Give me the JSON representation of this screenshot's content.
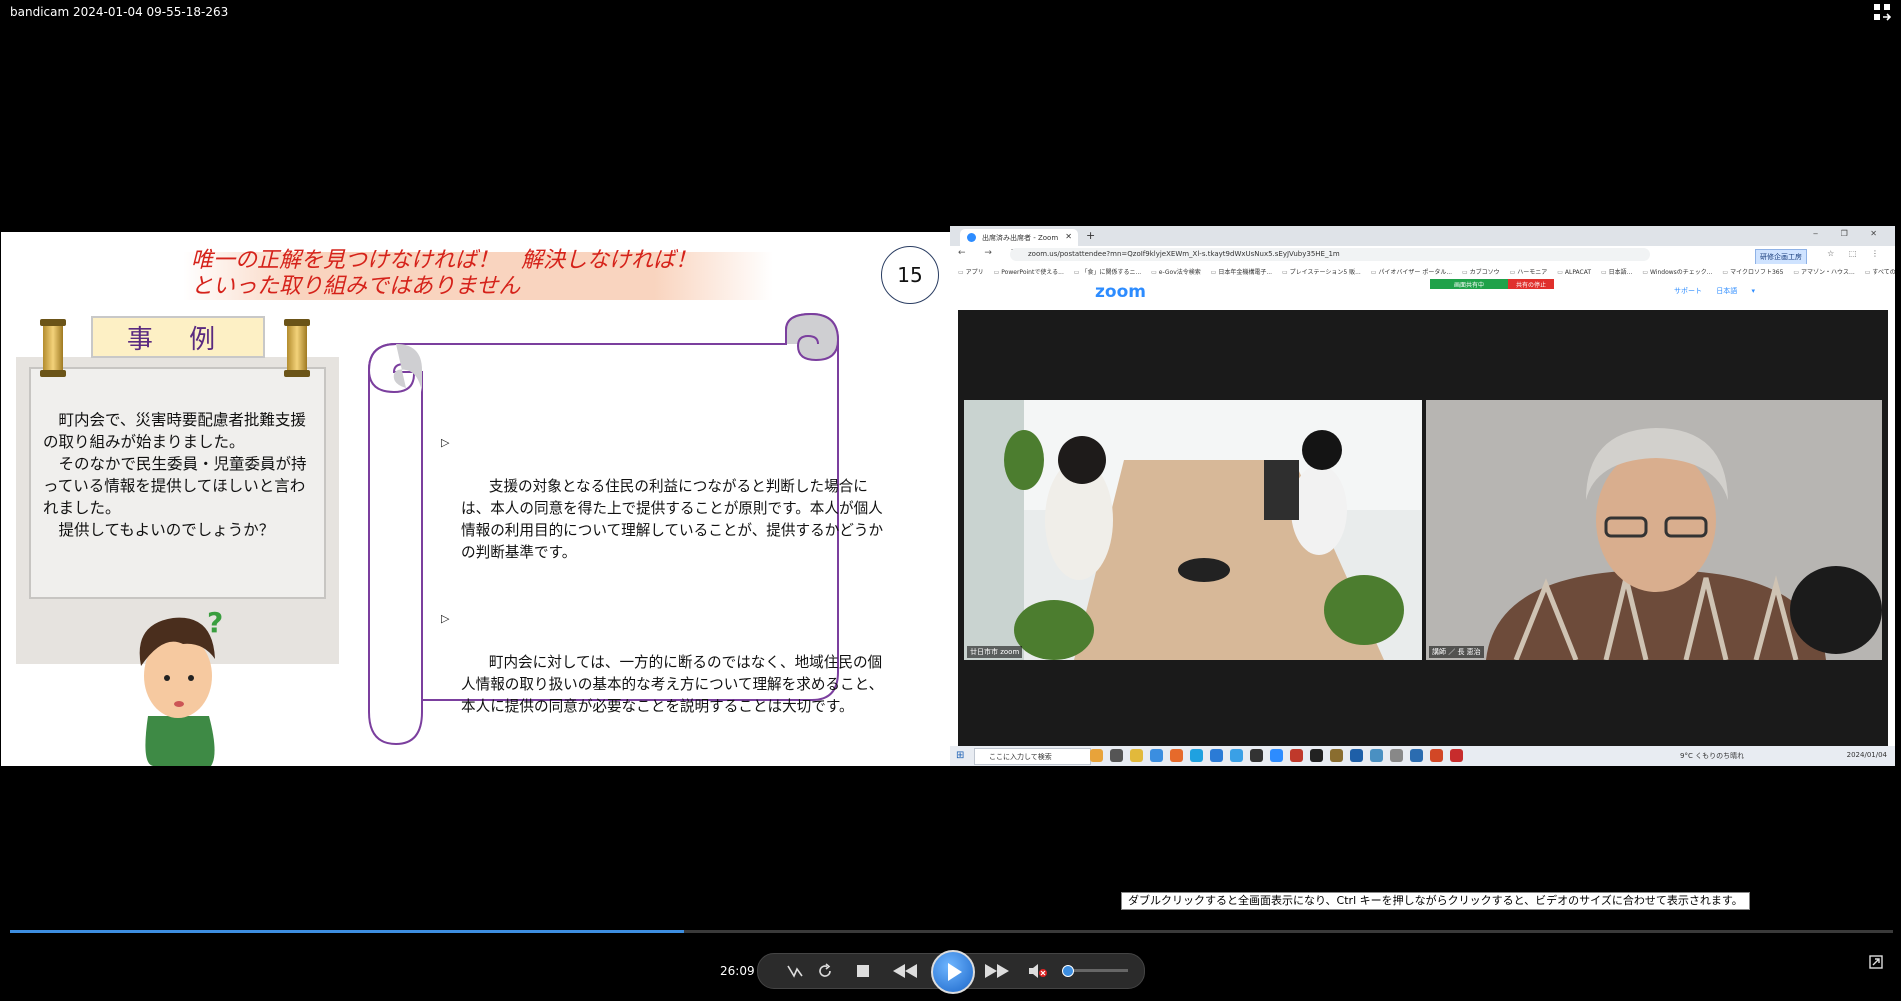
{
  "window": {
    "title": "bandicam 2024-01-04 09-55-18-263"
  },
  "slide": {
    "title_lines": [
      "唯一の正解を見つけなければ！　解決しなければ！",
      "といった取り組みではありません"
    ],
    "page_number": "15",
    "case_label": "事 例",
    "case_text": "　町内会で、災害時要配慮者批難支援の取り組みが始まりました。\n　そのなかで民生委員・児童委員が持っている情報を提供してほしいと言われました。\n　提供してもよいのでしょうか？",
    "bullets": [
      "支援の対象となる住民の利益につながると判断した場合には、本人の同意を得た上で提供することが原則です。本人が個人情報の利用目的について理解していることが、提供するかどうかの判断基準です。",
      "町内会に対しては、一方的に断るのではなく、地域住民の個人情報の取り扱いの基本的な考え方について理解を求めること、本人に提供の同意が必要なことを説明することは大切です。"
    ],
    "bullet_marker": "▷"
  },
  "browser": {
    "tab_title": "出席済み出席者 - Zoom",
    "url": "zoom.us/postattendee?mn=QzoIf9klyjeXEWm_Xl-s.tkayt9dWxUsNux5.sEyJVuby35HE_1m",
    "bookmarks": [
      "アプリ",
      "PowerPointで使える...",
      "「食」に関係するニ...",
      "e-Gov法令検索",
      "日本年金機構電子...",
      "プレイステーション5 販...",
      "パイオバイザー ポータル...",
      "カブコソウ",
      "ハーモニア",
      "ALPACAT",
      "日本語...",
      "Windowsのチェック...",
      "マイクロソフト365",
      "アマゾン・ハウス..."
    ],
    "bookmarks_more": "すべてのブックマーク",
    "share_status": "画面共有中",
    "share_stop": "共有の停止",
    "share_tooltip": "研修企画工房",
    "zoom_logo": "zoom",
    "zoom_links": "サポート 日本語 ▾",
    "video_labels": [
      "廿日市市 zoom",
      "講師 ／ 長 恵治"
    ],
    "taskbar_search": "ここに入力して検索",
    "taskbar_weather": "9°C くもりのち晴れ",
    "taskbar_time": "2024/01/04"
  },
  "player": {
    "tooltip": "ダブルクリックすると全画面表示になり、Ctrl キーを押しながらクリックすると、ビデオのサイズに合わせて表示されます。",
    "time": "26:09",
    "progress": 0.358,
    "volume": 0.05,
    "icons": [
      "fullscreen-restore-icon",
      "ab-repeat-icon",
      "loop-icon",
      "stop-icon",
      "rewind-icon",
      "play-icon",
      "fast-forward-icon",
      "mute-icon",
      "popout-icon"
    ]
  }
}
